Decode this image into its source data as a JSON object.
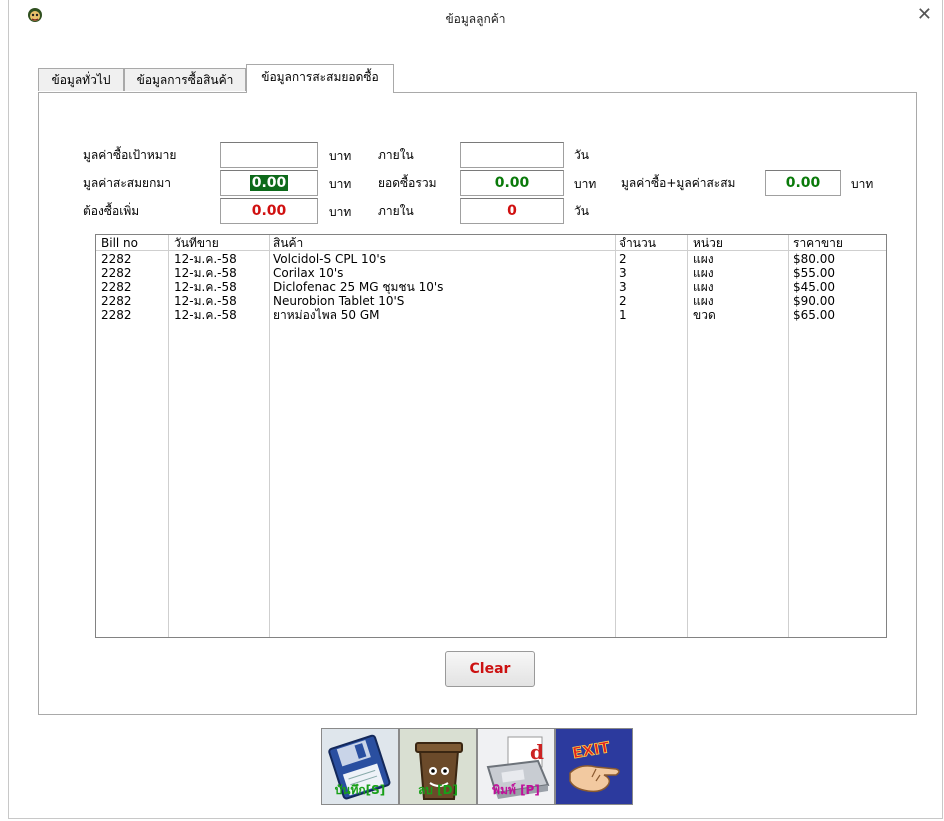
{
  "window": {
    "title": "ข้อมูลลูกค้า",
    "close_glyph": "✕"
  },
  "tabs": [
    {
      "label": "ข้อมูลทั่วไป",
      "active": false
    },
    {
      "label": "ข้อมูลการซื้อสินค้า",
      "active": false
    },
    {
      "label": "ข้อมูลการสะสมยอดซื้อ",
      "active": true
    }
  ],
  "form": {
    "target_label": "มูลค่าซื้อเป้าหมาย",
    "target_value": "",
    "baht1": "บาท",
    "within1": "ภายใน",
    "days_value1": "",
    "day1": "วัน",
    "carry_label": "มูลค่าสะสมยกมา",
    "carry_value": "0.00",
    "baht2": "บาท",
    "total_label": "ยอดซื้อรวม",
    "total_value": "0.00",
    "baht3": "บาท",
    "sum_label": "มูลค่าซื้อ+มูลค่าสะสม",
    "sum_value": "0.00",
    "baht4": "บาท",
    "need_label": "ต้องซื้อเพิ่ม",
    "need_value": "0.00",
    "baht5": "บาท",
    "within2": "ภายใน",
    "days_value2": "0",
    "day2": "วัน"
  },
  "table": {
    "headers": [
      "Bill no",
      "วันที่ขาย",
      "สินค้า",
      "จำนวน",
      "หน่วย",
      "ราคาขาย"
    ],
    "rows": [
      [
        "2282",
        "12-ม.ค.-58",
        "Volcidol-S CPL 10's",
        "2",
        "แผง",
        "$80.00"
      ],
      [
        "2282",
        "12-ม.ค.-58",
        "Corilax 10's",
        "3",
        "แผง",
        "$55.00"
      ],
      [
        "2282",
        "12-ม.ค.-58",
        "Diclofenac 25 MG ชุมชน 10's",
        "3",
        "แผง",
        "$45.00"
      ],
      [
        "2282",
        "12-ม.ค.-58",
        "Neurobion Tablet  10'S",
        "2",
        "แผง",
        "$90.00"
      ],
      [
        "2282",
        "12-ม.ค.-58",
        "ยาหม่องไพล 50 GM",
        "1",
        "ขวด",
        "$65.00"
      ]
    ]
  },
  "buttons": {
    "clear": "Clear"
  },
  "toolbar": [
    {
      "label": "บันทึก[S]",
      "icon": "floppy-disk-icon",
      "color": "#1a9a1a"
    },
    {
      "label": "ลบ [D]",
      "icon": "trash-bin-icon",
      "color": "#1a9a1a"
    },
    {
      "label": "พิมพ์ [P]",
      "icon": "printer-icon",
      "color": "#c0109a"
    },
    {
      "label": "",
      "icon": "exit-hand-icon",
      "color": "#c01010"
    }
  ]
}
